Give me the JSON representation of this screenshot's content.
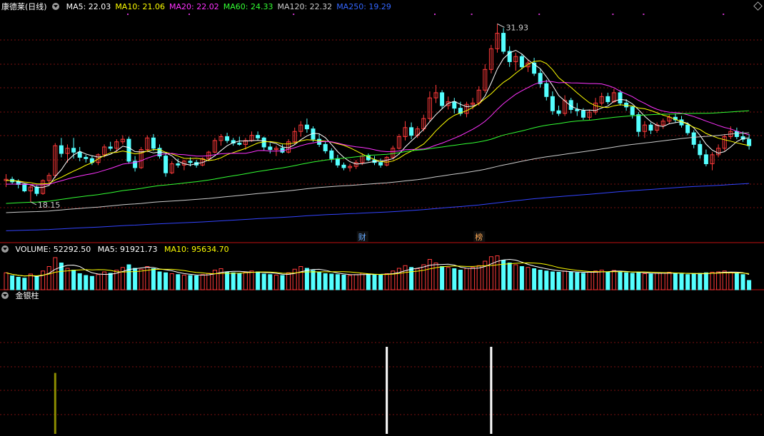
{
  "header": {
    "title": "康德莱(日线)",
    "ma": [
      {
        "label": "MA5: 22.03",
        "color": "#ffffff"
      },
      {
        "label": "MA10: 21.06",
        "color": "#ffff00"
      },
      {
        "label": "MA20: 22.02",
        "color": "#ff33ff"
      },
      {
        "label": "MA60: 24.33",
        "color": "#33ff33"
      },
      {
        "label": "MA120: 22.32",
        "color": "#cccccc"
      },
      {
        "label": "MA250: 19.29",
        "color": "#3366ff"
      }
    ]
  },
  "volume_header": {
    "label": "VOLUME: 52292.50",
    "ma5": "MA5: 91921.73",
    "ma10": "MA10: 95634.70"
  },
  "indicator_header": {
    "label": "金银柱"
  },
  "markers": {
    "cai": "财",
    "bang": "榜"
  },
  "colors": {
    "up": "#ff3a3a",
    "down": "#54ffff",
    "ma5": "#ffffff",
    "ma10": "#ffff00",
    "ma20": "#ff33ff",
    "ma60": "#33ff33",
    "ma120": "#cccccc",
    "ma250": "#3344ff",
    "grid": "#7a1010"
  },
  "chart_data": [
    {
      "type": "candlestick",
      "title": "康德莱(日线)",
      "ylim": [
        15,
        33
      ],
      "annotations": [
        {
          "text": "31.93",
          "kind": "high"
        },
        {
          "text": "18.15",
          "kind": "low"
        }
      ],
      "ohlc": [
        [
          19.8,
          20.3,
          19.3,
          19.9
        ],
        [
          19.9,
          20.1,
          19.5,
          19.7
        ],
        [
          19.7,
          19.9,
          19.2,
          19.5
        ],
        [
          19.5,
          19.6,
          18.9,
          19.0
        ],
        [
          19.0,
          19.5,
          18.15,
          19.3
        ],
        [
          19.3,
          19.4,
          18.6,
          18.8
        ],
        [
          18.8,
          19.9,
          18.7,
          19.8
        ],
        [
          19.8,
          20.4,
          19.5,
          20.2
        ],
        [
          20.2,
          22.7,
          20.0,
          22.5
        ],
        [
          22.5,
          23.1,
          21.6,
          21.9
        ],
        [
          21.9,
          22.6,
          21.2,
          22.3
        ],
        [
          22.3,
          23.1,
          21.5,
          22.0
        ],
        [
          22.0,
          22.4,
          21.3,
          21.6
        ],
        [
          21.6,
          21.8,
          21.2,
          21.5
        ],
        [
          21.5,
          21.7,
          21.0,
          21.2
        ],
        [
          21.2,
          21.9,
          21.0,
          21.8
        ],
        [
          21.8,
          22.6,
          21.6,
          22.4
        ],
        [
          22.4,
          22.8,
          22.1,
          22.3
        ],
        [
          22.3,
          23.0,
          22.0,
          22.8
        ],
        [
          22.8,
          23.3,
          22.6,
          23.0
        ],
        [
          23.0,
          23.2,
          21.1,
          21.3
        ],
        [
          21.3,
          21.7,
          20.5,
          20.8
        ],
        [
          20.8,
          22.4,
          20.7,
          22.2
        ],
        [
          22.2,
          23.3,
          22.0,
          23.1
        ],
        [
          23.1,
          23.4,
          22.1,
          22.3
        ],
        [
          22.3,
          22.6,
          21.5,
          21.7
        ],
        [
          21.7,
          21.9,
          20.1,
          20.4
        ],
        [
          20.4,
          21.3,
          20.3,
          21.1
        ],
        [
          21.1,
          21.5,
          20.8,
          21.0
        ],
        [
          21.0,
          21.4,
          20.6,
          21.3
        ],
        [
          21.3,
          21.6,
          20.9,
          21.2
        ],
        [
          21.2,
          21.4,
          20.8,
          21.0
        ],
        [
          21.0,
          21.6,
          20.9,
          21.5
        ],
        [
          21.5,
          22.1,
          21.3,
          22.0
        ],
        [
          22.0,
          23.1,
          21.9,
          22.9
        ],
        [
          22.9,
          23.4,
          22.5,
          23.2
        ],
        [
          23.2,
          23.5,
          22.7,
          22.9
        ],
        [
          22.9,
          23.1,
          22.5,
          22.7
        ],
        [
          22.7,
          23.2,
          22.5,
          22.6
        ],
        [
          22.6,
          23.1,
          22.2,
          22.9
        ],
        [
          22.9,
          23.6,
          22.8,
          23.3
        ],
        [
          23.3,
          23.6,
          22.9,
          23.1
        ],
        [
          23.1,
          23.2,
          22.1,
          22.4
        ],
        [
          22.4,
          22.7,
          21.9,
          22.2
        ],
        [
          22.2,
          22.5,
          21.7,
          22.3
        ],
        [
          22.3,
          22.6,
          21.9,
          22.0
        ],
        [
          22.0,
          23.0,
          21.9,
          22.8
        ],
        [
          22.8,
          23.9,
          22.6,
          23.6
        ],
        [
          23.6,
          24.4,
          23.2,
          24.1
        ],
        [
          24.1,
          24.6,
          23.5,
          23.8
        ],
        [
          23.8,
          24.0,
          22.8,
          23.0
        ],
        [
          23.0,
          23.4,
          22.4,
          22.6
        ],
        [
          22.6,
          22.8,
          21.9,
          22.1
        ],
        [
          22.1,
          22.3,
          21.2,
          21.5
        ],
        [
          21.5,
          21.8,
          20.8,
          21.0
        ],
        [
          21.0,
          21.2,
          20.6,
          20.8
        ],
        [
          20.8,
          21.1,
          20.5,
          20.9
        ],
        [
          20.9,
          21.4,
          20.7,
          21.2
        ],
        [
          21.2,
          21.9,
          21.0,
          21.7
        ],
        [
          21.7,
          21.9,
          21.3,
          21.4
        ],
        [
          21.4,
          21.7,
          21.0,
          21.2
        ],
        [
          21.2,
          21.5,
          20.8,
          21.0
        ],
        [
          21.0,
          21.7,
          20.9,
          21.6
        ],
        [
          21.6,
          22.5,
          21.5,
          22.3
        ],
        [
          22.3,
          23.4,
          22.2,
          23.2
        ],
        [
          23.2,
          24.4,
          22.9,
          23.9
        ],
        [
          23.9,
          24.3,
          23.0,
          23.3
        ],
        [
          23.3,
          24.0,
          23.1,
          23.8
        ],
        [
          23.8,
          24.9,
          23.6,
          24.6
        ],
        [
          24.6,
          26.7,
          24.4,
          26.2
        ],
        [
          26.2,
          27.2,
          25.8,
          26.6
        ],
        [
          26.6,
          26.8,
          25.4,
          25.6
        ],
        [
          25.6,
          26.3,
          25.3,
          25.9
        ],
        [
          25.9,
          26.2,
          25.0,
          25.4
        ],
        [
          25.4,
          25.9,
          24.8,
          25.0
        ],
        [
          25.0,
          25.9,
          24.7,
          25.7
        ],
        [
          25.7,
          26.2,
          25.3,
          25.8
        ],
        [
          25.8,
          27.1,
          25.6,
          26.8
        ],
        [
          26.8,
          28.8,
          26.6,
          28.4
        ],
        [
          28.4,
          30.3,
          28.1,
          30.0
        ],
        [
          30.0,
          31.93,
          29.7,
          31.2
        ],
        [
          31.2,
          31.6,
          29.6,
          29.8
        ],
        [
          29.8,
          30.2,
          28.6,
          29.0
        ],
        [
          29.0,
          29.7,
          28.3,
          29.4
        ],
        [
          29.4,
          29.6,
          28.4,
          28.6
        ],
        [
          28.6,
          29.2,
          28.2,
          28.9
        ],
        [
          28.9,
          29.3,
          27.9,
          28.1
        ],
        [
          28.1,
          28.4,
          27.0,
          27.3
        ],
        [
          27.3,
          27.6,
          26.0,
          26.3
        ],
        [
          26.3,
          26.7,
          24.9,
          25.2
        ],
        [
          25.2,
          25.6,
          24.8,
          25.0
        ],
        [
          25.0,
          26.4,
          24.8,
          26.0
        ],
        [
          26.0,
          26.2,
          25.0,
          25.3
        ],
        [
          25.3,
          25.8,
          24.8,
          25.2
        ],
        [
          25.2,
          25.4,
          24.5,
          24.7
        ],
        [
          24.7,
          25.3,
          24.5,
          25.1
        ],
        [
          25.1,
          26.2,
          24.9,
          25.8
        ],
        [
          25.8,
          26.6,
          25.6,
          26.3
        ],
        [
          26.3,
          26.6,
          25.7,
          25.9
        ],
        [
          25.9,
          26.9,
          25.8,
          26.6
        ],
        [
          26.6,
          26.8,
          25.6,
          25.8
        ],
        [
          25.8,
          26.1,
          25.2,
          25.5
        ],
        [
          25.5,
          25.6,
          24.6,
          24.9
        ],
        [
          24.9,
          25.1,
          23.2,
          23.6
        ],
        [
          23.6,
          24.4,
          23.1,
          24.1
        ],
        [
          24.1,
          24.3,
          23.4,
          23.7
        ],
        [
          23.7,
          24.3,
          23.5,
          24.1
        ],
        [
          24.1,
          24.6,
          23.8,
          24.4
        ],
        [
          24.4,
          24.9,
          24.2,
          24.7
        ],
        [
          24.7,
          25.0,
          24.3,
          24.5
        ],
        [
          24.5,
          24.8,
          23.9,
          24.1
        ],
        [
          24.1,
          24.3,
          23.3,
          23.5
        ],
        [
          23.5,
          23.7,
          22.3,
          22.6
        ],
        [
          22.6,
          22.9,
          21.5,
          21.8
        ],
        [
          21.8,
          22.2,
          20.9,
          21.1
        ],
        [
          21.1,
          22.0,
          20.6,
          21.8
        ],
        [
          21.8,
          22.6,
          21.6,
          22.3
        ],
        [
          22.3,
          23.4,
          22.1,
          23.2
        ],
        [
          23.2,
          24.0,
          23.0,
          23.6
        ],
        [
          23.6,
          23.9,
          23.0,
          23.2
        ],
        [
          23.2,
          23.6,
          22.8,
          23.0
        ],
        [
          23.0,
          23.4,
          22.2,
          22.5
        ]
      ]
    },
    {
      "type": "bar",
      "title": "VOLUME",
      "values": [
        95,
        78,
        70,
        65,
        88,
        72,
        105,
        130,
        180,
        150,
        120,
        110,
        90,
        80,
        75,
        85,
        100,
        92,
        110,
        125,
        140,
        120,
        115,
        130,
        118,
        100,
        95,
        90,
        85,
        82,
        80,
        78,
        85,
        92,
        110,
        118,
        100,
        95,
        92,
        98,
        105,
        100,
        88,
        85,
        82,
        80,
        95,
        115,
        130,
        120,
        108,
        98,
        90,
        88,
        85,
        82,
        80,
        85,
        92,
        88,
        85,
        82,
        90,
        105,
        120,
        135,
        125,
        118,
        140,
        170,
        150,
        130,
        125,
        118,
        110,
        120,
        125,
        135,
        160,
        185,
        190,
        165,
        150,
        140,
        130,
        125,
        118,
        110,
        105,
        100,
        98,
        105,
        100,
        95,
        92,
        98,
        105,
        110,
        100,
        108,
        100,
        95,
        92,
        98,
        90,
        88,
        92,
        95,
        98,
        92,
        88,
        85,
        90,
        92,
        95,
        98,
        100,
        105,
        98,
        90,
        85,
        52
      ]
    },
    {
      "type": "bar",
      "title": "金银柱",
      "bars": [
        {
          "index": 8,
          "value": 0.7,
          "color": "#8b8b00"
        },
        {
          "index": 62,
          "value": 1.0,
          "color": "#ffffff"
        },
        {
          "index": 79,
          "value": 1.0,
          "color": "#ffffff"
        }
      ]
    }
  ]
}
